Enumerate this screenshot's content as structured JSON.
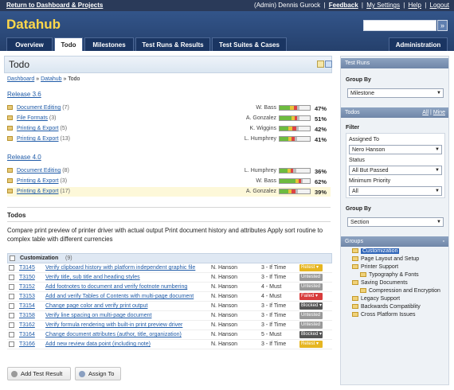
{
  "topbar": {
    "return_link": "Return to Dashboard & Projects",
    "user": "(Admin) Dennis Gurock",
    "feedback": "Feedback",
    "settings": "My Settings",
    "help": "Help",
    "logout": "Logout"
  },
  "header": {
    "title": "Datahub",
    "search_button": "»"
  },
  "tabs": [
    {
      "label": "Overview"
    },
    {
      "label": "Todo"
    },
    {
      "label": "Milestones"
    },
    {
      "label": "Test Runs & Results"
    },
    {
      "label": "Test Suites & Cases"
    },
    {
      "label": "Administration"
    }
  ],
  "main": {
    "title": "Todo",
    "breadcrumb": {
      "dashboard": "Dashboard",
      "sep1": "»",
      "project": "Datahub",
      "sep2": "»",
      "current": "Todo"
    },
    "releases": [
      {
        "name": "Release 3.6",
        "rows": [
          {
            "name": "Document Editing",
            "count": "(7)",
            "user": "W. Bass",
            "pct": "47%",
            "highlight": false,
            "bar": [
              35,
              12,
              10,
              8,
              35
            ]
          },
          {
            "name": "File Formats",
            "count": "(3)",
            "user": "A. Gonzalez",
            "pct": "51%",
            "highlight": false,
            "bar": [
              40,
              10,
              8,
              8,
              34
            ]
          },
          {
            "name": "Printing & Export",
            "count": "(5)",
            "user": "K. Wiggins",
            "pct": "42%",
            "highlight": false,
            "bar": [
              30,
              12,
              12,
              8,
              38
            ]
          },
          {
            "name": "Printing & Export",
            "count": "(13)",
            "user": "L. Humphrey",
            "pct": "41%",
            "highlight": false,
            "bar": [
              30,
              10,
              10,
              8,
              42
            ]
          }
        ]
      },
      {
        "name": "Release 4.0",
        "rows": [
          {
            "name": "Document Editing",
            "count": "(8)",
            "user": "L. Humphrey",
            "pct": "36%",
            "highlight": false,
            "bar": [
              26,
              10,
              10,
              10,
              44
            ]
          },
          {
            "name": "Printing & Export",
            "count": "(3)",
            "user": "W. Bass",
            "pct": "62%",
            "highlight": false,
            "bar": [
              52,
              10,
              8,
              5,
              25
            ]
          },
          {
            "name": "Printing & Export",
            "count": "(17)",
            "user": "A. Gonzalez",
            "pct": "39%",
            "highlight": true,
            "bar": [
              28,
              12,
              12,
              8,
              40
            ]
          }
        ]
      }
    ],
    "todos_heading": "Todos",
    "description": "Compare print preview of printer driver with actual output Print document history and attributes Apply sort routine to complex table with different currencies",
    "group": {
      "name": "Customization",
      "count": "(9)"
    },
    "tests": [
      {
        "id": "T3145",
        "title": "Verify clipboard history with platform independent graphic file",
        "assignee": "N. Hanson",
        "priority": "3 - If Time",
        "status": "Retest",
        "status_class": "st-retest"
      },
      {
        "id": "T3150",
        "title": "Verify title, sub title and heading styles",
        "assignee": "N. Hanson",
        "priority": "3 - If Time",
        "status": "Untested",
        "status_class": "st-untested"
      },
      {
        "id": "T3152",
        "title": "Add footnotes to document and verify footnote numbering",
        "assignee": "N. Hanson",
        "priority": "4 - Must",
        "status": "Untested",
        "status_class": "st-untested"
      },
      {
        "id": "T3153",
        "title": "Add and verify Tables of Contents with multi-page document",
        "assignee": "N. Hanson",
        "priority": "4 - Must",
        "status": "Failed",
        "status_class": "st-failed"
      },
      {
        "id": "T3154",
        "title": "Change page color and verify print output",
        "assignee": "N. Hanson",
        "priority": "3 - If Time",
        "status": "Blocked",
        "status_class": "st-blocked"
      },
      {
        "id": "T3158",
        "title": "Verify line spacing on multi-page document",
        "assignee": "N. Hanson",
        "priority": "3 - If Time",
        "status": "Untested",
        "status_class": "st-untested"
      },
      {
        "id": "T3162",
        "title": "Verify formula rendering with built-in print preview driver",
        "assignee": "N. Hanson",
        "priority": "3 - If Time",
        "status": "Untested",
        "status_class": "st-untested"
      },
      {
        "id": "T3164",
        "title": "Change document attributes (author, title, organization)",
        "assignee": "N. Hanson",
        "priority": "5 - Must",
        "status": "Blocked",
        "status_class": "st-blocked"
      },
      {
        "id": "T3166",
        "title": "Add new review data point (including note)",
        "assignee": "N. Hanson",
        "priority": "3 - If Time",
        "status": "Retest",
        "status_class": "st-retest"
      }
    ],
    "add_result_button": "Add Test Result",
    "assign_button": "Assign To"
  },
  "sidebar": {
    "test_runs_header": "Test Runs",
    "group_by_label": "Group By",
    "group_by_value": "Milestone",
    "todos_header": "Todos",
    "all_link": "All",
    "sep": "|",
    "mine_link": "Mine",
    "filter_label": "Filter",
    "assigned_to_label": "Assigned To",
    "assigned_to_value": "Nero Hanson",
    "status_label": "Status",
    "status_value": "All But Passed",
    "min_priority_label": "Minimum Priority",
    "min_priority_value": "All",
    "group_by2_label": "Group By",
    "group_by2_value": "Section",
    "groups_header": "Groups",
    "groups": [
      "Customization",
      "Page Layout and Setup",
      "Printer Support",
      "Typography & Fonts",
      "Saving Documents",
      "Compression and Encryption",
      "Legacy Support",
      "Backwards Compatiblity",
      "Cross Platform Issues"
    ]
  },
  "colors": {
    "brand_yellow": "#ffd84a",
    "header_blue": "#25406c",
    "bar_green": "#6dbb3f",
    "bar_yellow": "#e6c53a",
    "bar_red": "#d44",
    "bar_gray": "#bdbdbd",
    "bar_blank": "#f2f2f2"
  }
}
